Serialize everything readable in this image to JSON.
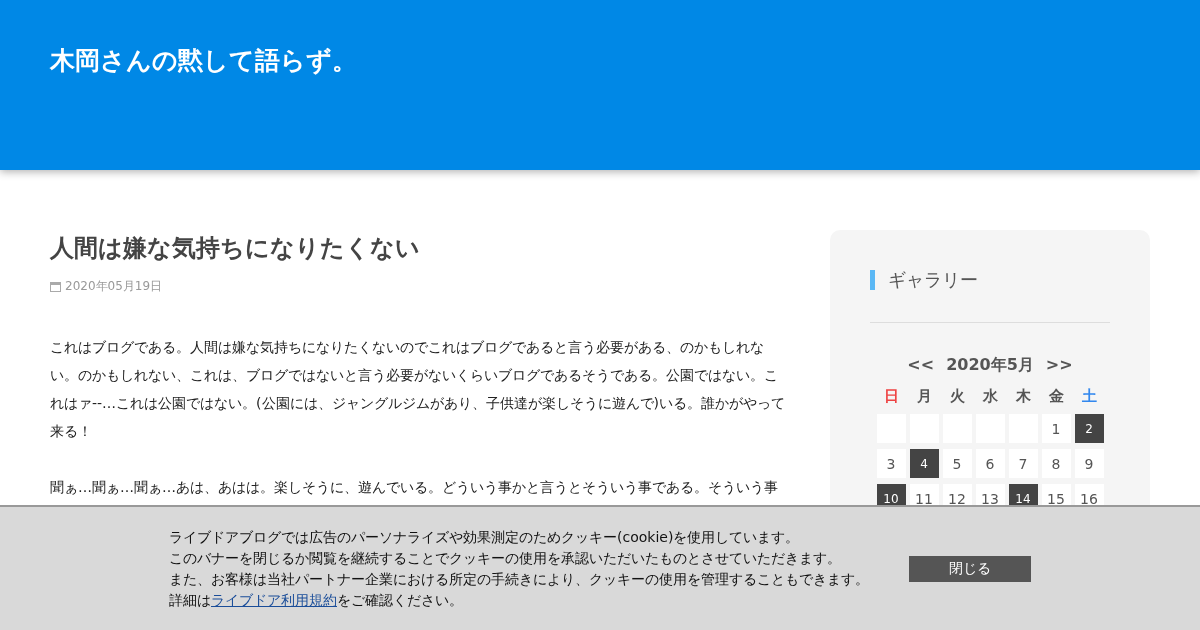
{
  "header": {
    "site_title": "木岡さんの黙して語らず。"
  },
  "article": {
    "title": "人間は嫌な気持ちになりたくない",
    "date": "2020年05月19日",
    "paragraphs": [
      "これはブログである。人間は嫌な気持ちになりたくないのでこれはブログであると言う必要がある、のかもしれない。のかもしれない、これは、ブログではないと言う必要がないくらいブログであるそうである。公園ではない。これはァ--…これは公園ではない。(公園には、ジャングルジムがあり、子供達が楽しそうに遊んで)いる。誰かがやって来る！",
      "聞ぁ…聞ぁ…聞ぁ…あは、あはは。楽しそうに、遊んでいる。どういう事かと言うとそういう事である。そういう事"
    ]
  },
  "sidebar": {
    "heading": "ギャラリー",
    "calendar": {
      "prev": "<<",
      "month": "2020年5月",
      "next": ">>",
      "weekdays": [
        {
          "label": "日",
          "color": "#ee4444"
        },
        {
          "label": "月",
          "color": "#555555"
        },
        {
          "label": "火",
          "color": "#555555"
        },
        {
          "label": "水",
          "color": "#555555"
        },
        {
          "label": "木",
          "color": "#555555"
        },
        {
          "label": "金",
          "color": "#555555"
        },
        {
          "label": "土",
          "color": "#3388ee"
        }
      ],
      "weeks": [
        [
          {
            "kind": "blank"
          },
          {
            "kind": "blank"
          },
          {
            "kind": "blank"
          },
          {
            "kind": "blank"
          },
          {
            "kind": "blank"
          },
          {
            "kind": "day",
            "label": "1",
            "has_entry": false
          },
          {
            "kind": "day",
            "label": "2",
            "has_entry": true
          }
        ],
        [
          {
            "kind": "day",
            "label": "3",
            "has_entry": false
          },
          {
            "kind": "day",
            "label": "4",
            "has_entry": true
          },
          {
            "kind": "day",
            "label": "5",
            "has_entry": false
          },
          {
            "kind": "day",
            "label": "6",
            "has_entry": false
          },
          {
            "kind": "day",
            "label": "7",
            "has_entry": false
          },
          {
            "kind": "day",
            "label": "8",
            "has_entry": false
          },
          {
            "kind": "day",
            "label": "9",
            "has_entry": false
          }
        ],
        [
          {
            "kind": "day",
            "label": "10",
            "has_entry": true
          },
          {
            "kind": "day",
            "label": "11",
            "has_entry": false
          },
          {
            "kind": "day",
            "label": "12",
            "has_entry": false
          },
          {
            "kind": "day",
            "label": "13",
            "has_entry": false
          },
          {
            "kind": "day",
            "label": "14",
            "has_entry": true
          },
          {
            "kind": "day",
            "label": "15",
            "has_entry": false
          },
          {
            "kind": "day",
            "label": "16",
            "has_entry": false
          }
        ]
      ]
    }
  },
  "cookie_banner": {
    "lines": [
      "ライブドアブログでは広告のパーソナライズや効果測定のためクッキー(cookie)を使用しています。",
      "このバナーを閉じるか閲覧を継続することでクッキーの使用を承認いただいたものとさせていただきます。",
      "また、お客様は当社パートナー企業における所定の手続きにより、クッキーの使用を管理することもできます。"
    ],
    "detail_prefix": "詳細は",
    "detail_link": "ライブドア利用規約",
    "detail_suffix": "をご確認ください。",
    "close_button": "閉じる"
  }
}
